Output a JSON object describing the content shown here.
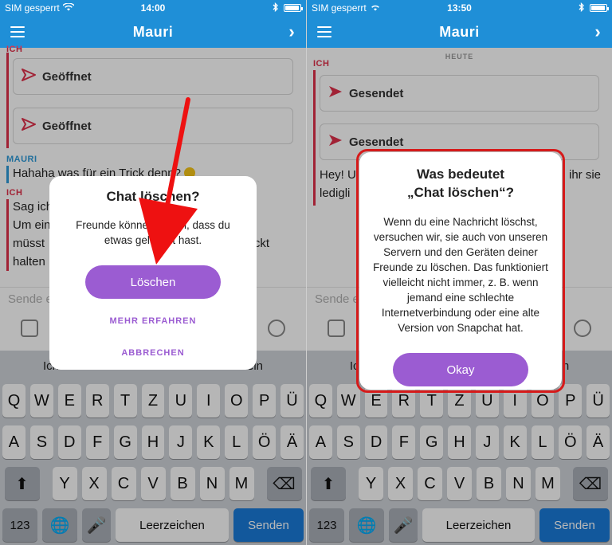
{
  "left": {
    "status": {
      "carrier": "SIM gesperrt",
      "time": "14:00"
    },
    "nav": {
      "title": "Mauri"
    },
    "chat": {
      "sender_top": "ICH",
      "snaps": [
        "Geöffnet",
        "Geöffnet"
      ],
      "sender_friend": "MAURI",
      "friend_msg": "Hahaha was für ein Trick denn?",
      "sender_me": "ICH",
      "my_lines": [
        "Sag ich",
        "Um ein",
        "müsst",
        "halten"
      ],
      "right_fragment": "ckt"
    },
    "input_placeholder": "Sende e",
    "suggestions": [
      "Ich",
      "",
      "ein"
    ],
    "dialog": {
      "title": "Chat löschen?",
      "body": "Freunde können sehen, dass du etwas gelöscht hast.",
      "primary": "Löschen",
      "learn_more": "MEHR ERFAHREN",
      "cancel": "ABBRECHEN"
    }
  },
  "right": {
    "status": {
      "carrier": "SIM gesperrt",
      "time": "13:50"
    },
    "nav": {
      "title": "Mauri"
    },
    "chat": {
      "day": "HEUTE",
      "sender_top": "ICH",
      "snaps": [
        "Gesendet",
        "Gesendet"
      ],
      "my_lines": [
        "Hey! U",
        "ledigli"
      ],
      "right_fragment": "ihr sie"
    },
    "input_placeholder": "Sende e",
    "suggestions": [
      "Ich",
      "",
      "ein"
    ],
    "dialog": {
      "title_line1": "Was bedeutet",
      "title_line2": "„Chat löschen“?",
      "body": "Wenn du eine Nachricht löschst, versuchen wir, sie auch von unseren Servern und den Geräten deiner Freunde zu löschen. Das funktioniert vielleicht nicht immer, z. B. wenn jemand eine schlechte Internetverbindung oder eine alte Version von Snapchat hat.",
      "primary": "Okay"
    }
  },
  "keyboard": {
    "row1": [
      "Q",
      "W",
      "E",
      "R",
      "T",
      "Z",
      "U",
      "I",
      "O",
      "P",
      "Ü"
    ],
    "row2": [
      "A",
      "S",
      "D",
      "F",
      "G",
      "H",
      "J",
      "K",
      "L",
      "Ö",
      "Ä"
    ],
    "row3": [
      "Y",
      "X",
      "C",
      "V",
      "B",
      "N",
      "M"
    ],
    "num": "123",
    "space": "Leerzeichen",
    "send": "Senden"
  },
  "colors": {
    "nav": "#1f8fd7",
    "accent": "#9b5cd2",
    "me": "#e0304a",
    "friend": "#2e9ad8",
    "highlight": "#d61a1a",
    "send": "#1a7bd8"
  }
}
